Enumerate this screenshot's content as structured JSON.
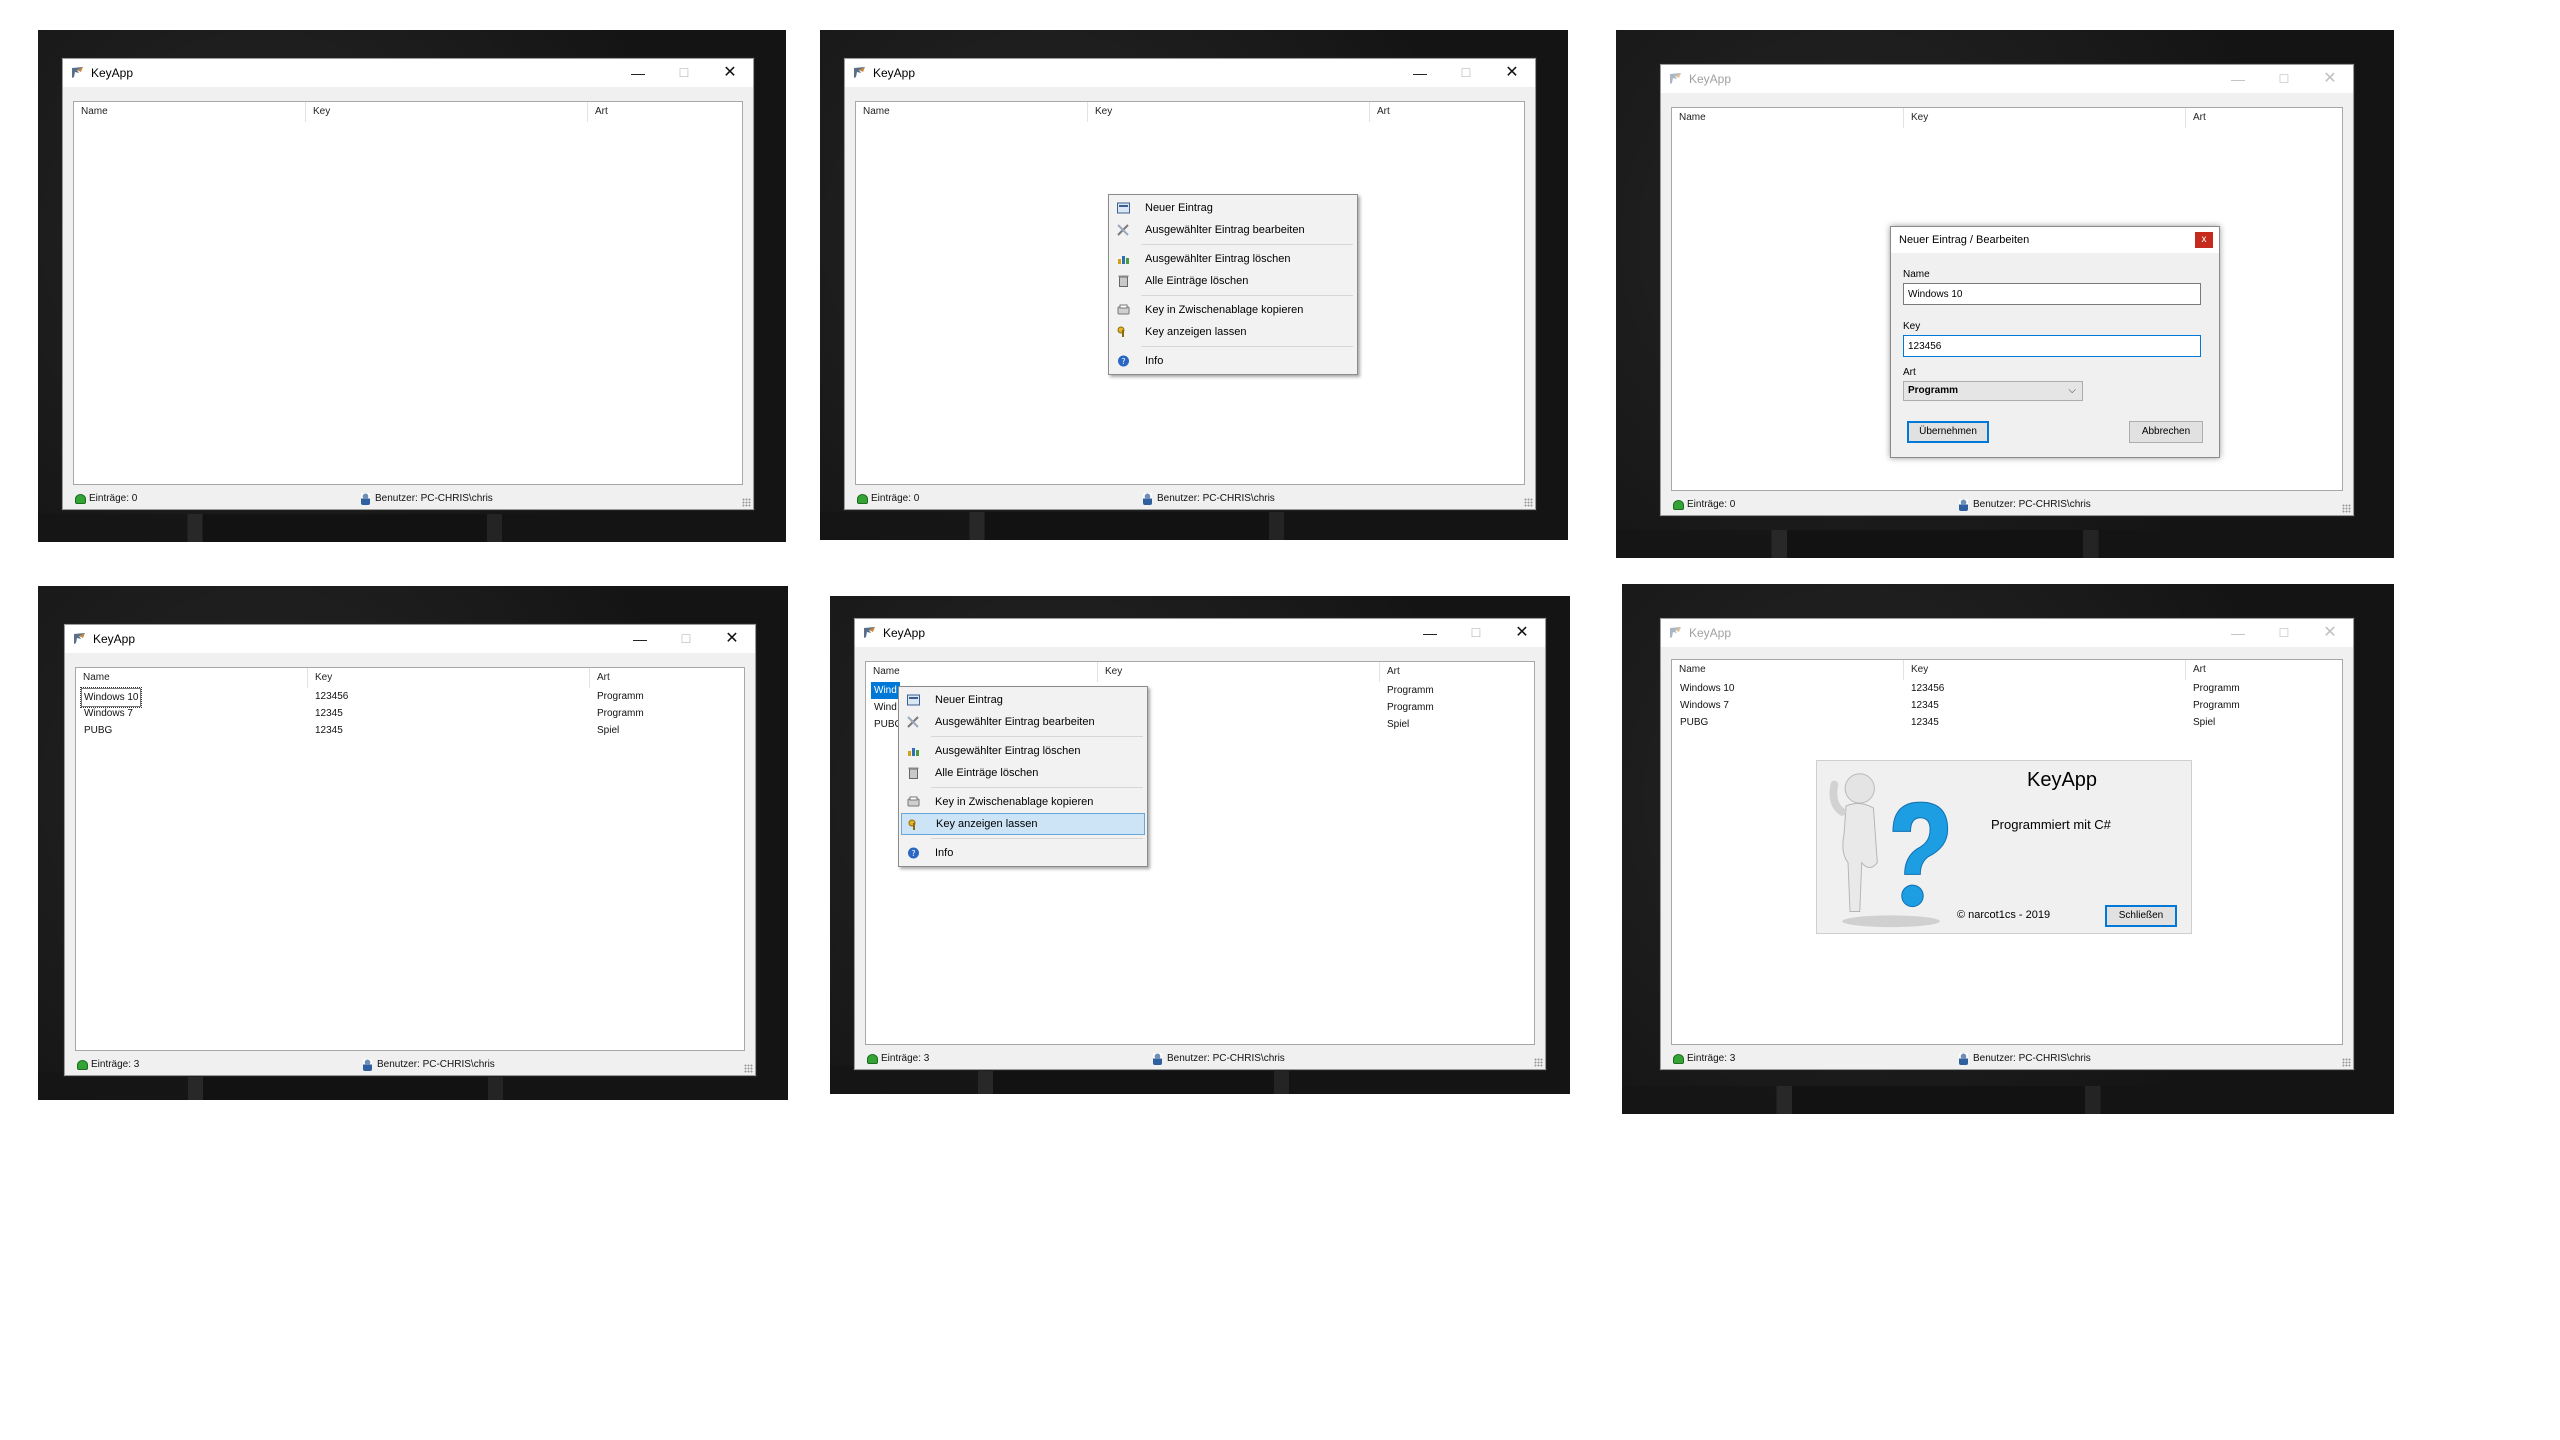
{
  "app": {
    "title": "KeyApp",
    "minimize_glyph": "—",
    "maximize_glyph": "☐",
    "close_glyph": "✕"
  },
  "columns": {
    "name": "Name",
    "key": "Key",
    "art": "Art"
  },
  "status": {
    "count_empty": "Einträge: 0",
    "count_full": "Einträge: 3",
    "user": "Benutzer: PC-CHRIS\\chris"
  },
  "entries": [
    {
      "name": "Windows 10",
      "key": "123456",
      "art": "Programm"
    },
    {
      "name": "Windows 7",
      "key": "12345",
      "art": "Programm"
    },
    {
      "name": "PUBG",
      "key": "12345",
      "art": "Spiel"
    }
  ],
  "partial_names": {
    "row1": "Wind",
    "row2": "Wind",
    "row3": "PUBG"
  },
  "context_menu": {
    "items": [
      {
        "label": "Neuer Eintrag",
        "icon": "new-entry-icon"
      },
      {
        "label": "Ausgewählter Eintrag bearbeiten",
        "icon": "edit-tools-icon"
      },
      {
        "label": "Ausgewählter Eintrag löschen",
        "icon": "delete-chart-icon"
      },
      {
        "label": "Alle Einträge löschen",
        "icon": "trash-can-icon"
      },
      {
        "label": "Key in Zwischenablage kopieren",
        "icon": "clipboard-icon"
      },
      {
        "label": "Key anzeigen lassen",
        "icon": "key-icon"
      },
      {
        "label": "Info",
        "icon": "info-icon"
      }
    ],
    "highlighted_index": 5
  },
  "edit_dialog": {
    "title": "Neuer Eintrag / Bearbeiten",
    "close_glyph": "x",
    "name_label": "Name",
    "name_value": "Windows 10",
    "key_label": "Key",
    "key_value": "123456",
    "art_label": "Art",
    "art_value": "Programm",
    "apply_button": "Übernehmen",
    "cancel_button": "Abbrechen"
  },
  "about": {
    "title": "KeyApp",
    "subtitle": "Programmiert mit C#",
    "copyright": "© narcot1cs - 2019",
    "close_button": "Schließen"
  },
  "colors": {
    "selection": "#0078d7",
    "menu_highlight": "#cde4f7",
    "dialog_close": "#c42b1c",
    "status_icon_green": "#33a336"
  }
}
